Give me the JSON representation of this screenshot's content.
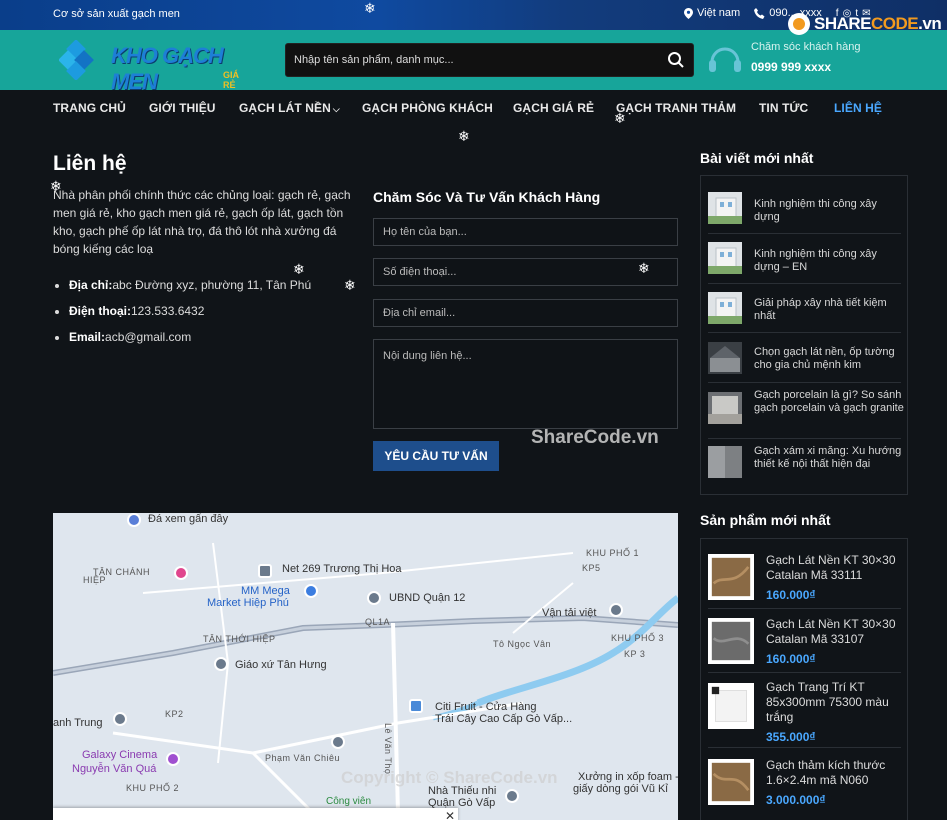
{
  "topbar": {
    "tagline": "Cơ sở sản xuất gạch men",
    "location": "Việt nam",
    "phone": "090... xxxx"
  },
  "header": {
    "logo_text": "KHO GẠCH MEN",
    "logo_sub": "GIÁ RẺ",
    "search_placeholder": "Nhập tên sản phẩm, danh mục...",
    "care_label": "Chăm sóc khách hàng",
    "care_phone": "0999 999 xxxx"
  },
  "badge": {
    "text_a": "SHARE",
    "text_b": "CODE",
    "text_c": ".vn"
  },
  "nav": [
    {
      "label": "TRANG CHỦ"
    },
    {
      "label": "GIỚI THIỆU"
    },
    {
      "label": "GẠCH LÁT NỀN"
    },
    {
      "label": "GẠCH PHÒNG KHÁCH"
    },
    {
      "label": "GẠCH GIÁ RẺ"
    },
    {
      "label": "GẠCH TRANH THẢM"
    },
    {
      "label": "TIN TỨC"
    },
    {
      "label": "LIÊN HỆ"
    }
  ],
  "contact": {
    "title": "Liên hệ",
    "intro": "Nhà phân phối chính thức các chủng loại: gạch rẻ, gạch men giá rẻ, kho gạch men giá rẻ, gạch ốp lát, gạch tồn kho, gạch phế ốp lát nhà trọ, đá thô lót nhà xưởng đá bóng kiếng các loạ",
    "items": [
      {
        "label": "Địa chỉ:",
        "value": "abc Đường xyz, phường 11, Tân Phú"
      },
      {
        "label": "Điện thoại:",
        "value": "123.533.6432"
      },
      {
        "label": "Email:",
        "value": "acb@gmail.com"
      }
    ]
  },
  "form": {
    "title": "Chăm Sóc Và Tư Vấn Khách Hàng",
    "name_placeholder": "Họ tên của bạn...",
    "phone_placeholder": "Số điện thoại...",
    "email_placeholder": "Địa chỉ email...",
    "message_placeholder": "Nội dung liên hệ...",
    "submit_label": "YÊU CẦU TƯ VẤN"
  },
  "watermarks": {
    "mid": "ShareCode.vn",
    "copyright": "Copyright © ShareCode.vn"
  },
  "map": {
    "labels": [
      "Đá xem gấn đây",
      "TÂN CHÁNH",
      "HIỆP",
      "Net 269 Trương Thị Hoa",
      "MM Mega",
      "Market Hiệp Phú",
      "UBND Quận 12",
      "KHU PHỐ 1",
      "KP5",
      "Vận tải việt",
      "QL1A",
      "TÂN THỚI HIỆP",
      "Giáo xứ Tân Hưng",
      "KHU PHỐ 3",
      "KP 3",
      "Tô Ngọc Vân",
      "Citi Fruit - Cửa Hàng",
      "Trái Cây Cao Cấp Gò Vấp...",
      "KP2",
      "anh Trung",
      "Galaxy Cinema",
      "Nguyễn Văn Quá",
      "Phạm Văn Chiêu",
      "KHU PHỐ 2",
      "Lê Văn Thọ",
      "Nhà Thiếu nhi",
      "Quận Gò Vấp",
      "Xưởng in xốp foam -",
      "giấy dòng gói Vũ Kỉ",
      "Công viên"
    ]
  },
  "sidebar": {
    "posts_title": "Bài viết mới nhất",
    "posts": [
      {
        "title": "Kinh nghiệm thi công xây dựng"
      },
      {
        "title": "Kinh nghiệm thi công xây dựng – EN"
      },
      {
        "title": "Giải pháp xây nhà tiết kiệm nhất"
      },
      {
        "title": "Chọn gạch lát nền, ốp tường cho gia chủ mệnh kim"
      },
      {
        "title": "Gạch porcelain là gì? So sánh gạch porcelain và gạch granite"
      },
      {
        "title": "Gạch xám xi măng: Xu hướng thiết kế nội thất hiện đại"
      }
    ],
    "products_title": "Sản phẩm mới nhất",
    "products": [
      {
        "title": "Gạch Lát Nền KT 30×30 Catalan Mã 33111",
        "price": "160.000₫"
      },
      {
        "title": "Gạch Lát Nền KT 30×30 Catalan Mã 33107",
        "price": "160.000₫"
      },
      {
        "title": "Gạch Trang Trí KT 85x300mm 75300 màu trắng",
        "price": "355.000₫"
      },
      {
        "title": "Gạch thảm kích thước 1.6×2.4m mã N060",
        "price": "3.000.000₫"
      }
    ]
  },
  "colors": {
    "accent": "#4aa8ff",
    "band": "#17a59a",
    "button": "#1e4e8c",
    "background": "#101418"
  }
}
